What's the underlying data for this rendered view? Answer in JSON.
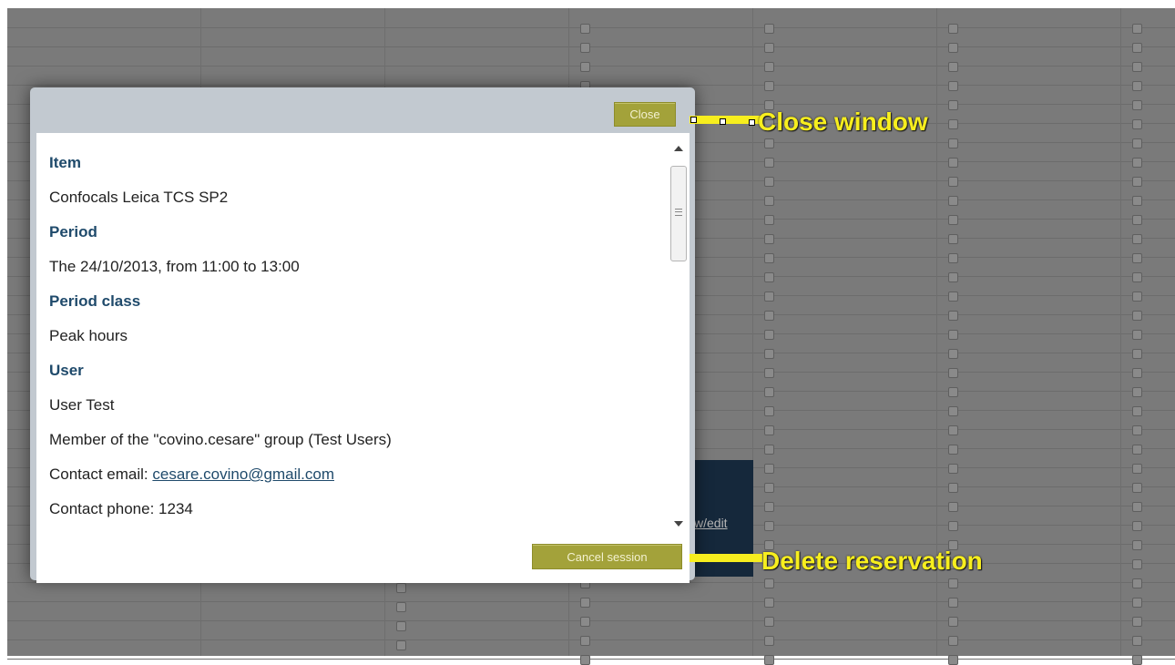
{
  "dialog": {
    "close_label": "Close",
    "cancel_label": "Cancel session",
    "fields": {
      "item_label": "Item",
      "item_value": "Confocals Leica TCS SP2",
      "period_label": "Period",
      "period_value": "The 24/10/2013, from 11:00 to 13:00",
      "period_class_label": "Period class",
      "period_class_value": "Peak hours",
      "user_label": "User",
      "user_name": "User Test",
      "user_group": "Member of the \"covino.cesare\" group (Test Users)",
      "contact_email_prefix": "Contact email: ",
      "contact_email": "cesare.covino@gmail.com",
      "contact_phone": "Contact phone: 1234"
    }
  },
  "background": {
    "link_text": "w/edit"
  },
  "annotations": {
    "close_window": "Close window",
    "delete_reservation": "Delete reservation"
  },
  "colors": {
    "button": "#a3a23a",
    "label": "#1f4a6b",
    "annotation": "#f7ee1e"
  }
}
